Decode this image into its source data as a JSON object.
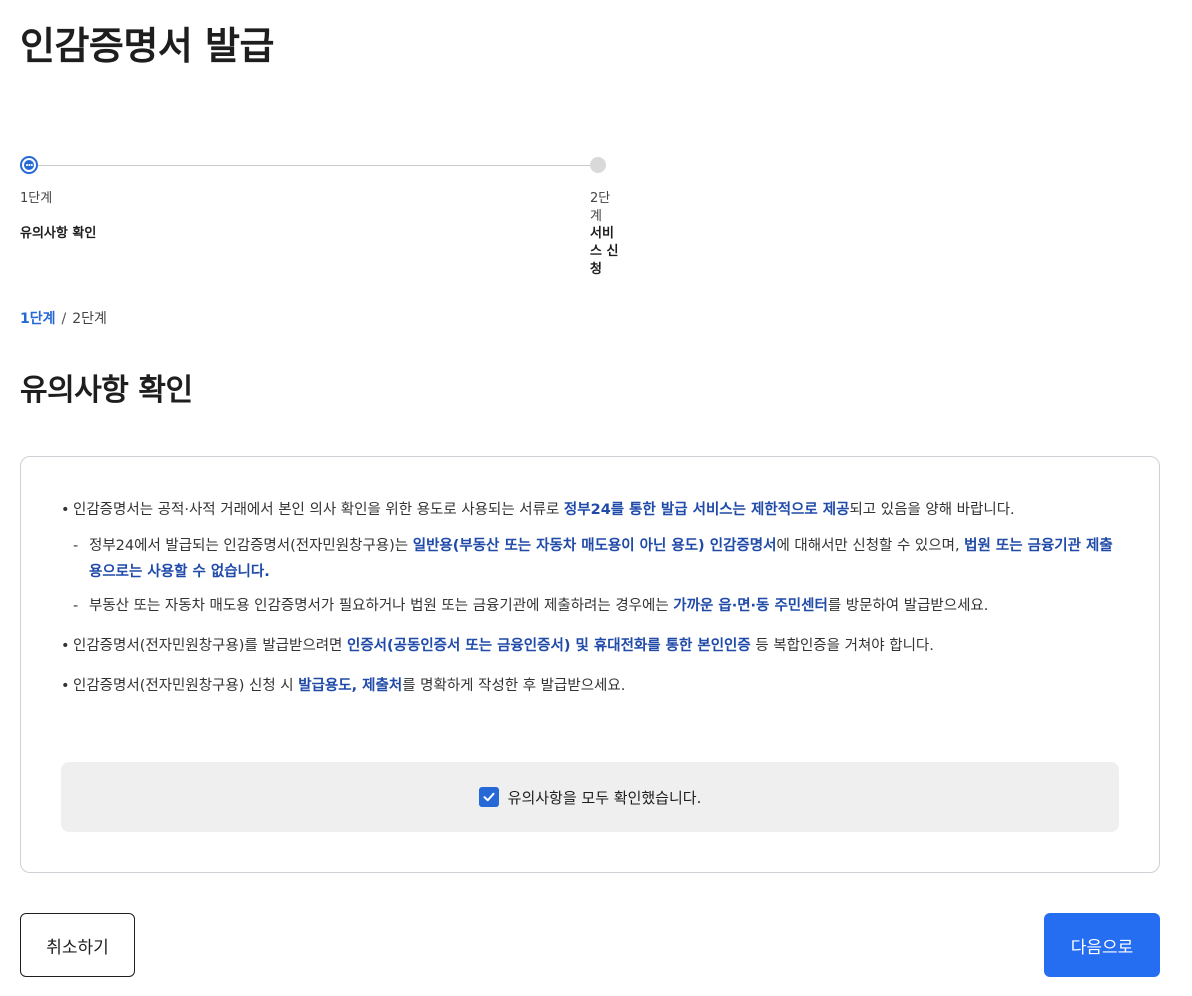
{
  "page": {
    "title": "인감증명서 발급"
  },
  "stepper": {
    "steps": [
      {
        "number": "1단계",
        "name": "유의사항 확인",
        "state": "current"
      },
      {
        "number": "2단계",
        "name": "서비스 신청",
        "state": "pending"
      }
    ]
  },
  "breadcrumb": {
    "current": "1단계",
    "separator": "/",
    "total": "2단계"
  },
  "section": {
    "title": "유의사항 확인"
  },
  "notices": {
    "item1": {
      "text_a": "인감증명서는 공적·사적 거래에서 본인 의사 확인을 위한 용도로 사용되는 서류로 ",
      "hl_a": "정부24를 통한 발급 서비스는 제한적으로 제공",
      "text_b": "되고 있음을 양해 바랍니다.",
      "sub1": {
        "text_a": "정부24에서 발급되는 인감증명서(전자민원창구용)는 ",
        "hl_a": "일반용(부동산 또는 자동차 매도용이 아닌 용도) 인감증명서",
        "text_b": "에 대해서만 신청할 수 있으며, ",
        "hl_b": "법원 또는 금융기관 제출용으로는 사용할 수 없습니다."
      },
      "sub2": {
        "text_a": "부동산 또는 자동차 매도용 인감증명서가 필요하거나 법원 또는 금융기관에 제출하려는 경우에는 ",
        "hl_a": "가까운 읍·면·동 주민센터",
        "text_b": "를 방문하여 발급받으세요."
      }
    },
    "item2": {
      "text_a": "인감증명서(전자민원창구용)를 발급받으려면 ",
      "hl_a": "인증서(공동인증서 또는 금융인증서) 및 휴대전화를 통한 본인인증",
      "text_b": " 등 복합인증을 거쳐야 합니다."
    },
    "item3": {
      "text_a": "인감증명서(전자민원창구용) 신청 시 ",
      "hl_a": "발급용도, 제출처",
      "text_b": "를 명확하게 작성한 후 발급받으세요."
    }
  },
  "confirm": {
    "label": "유의사항을 모두 확인했습니다.",
    "checked": true
  },
  "buttons": {
    "cancel": "취소하기",
    "next": "다음으로"
  },
  "colors": {
    "accent": "#2568d6",
    "highlight_text": "#1f4aa8",
    "primary_button": "#256ef1"
  }
}
